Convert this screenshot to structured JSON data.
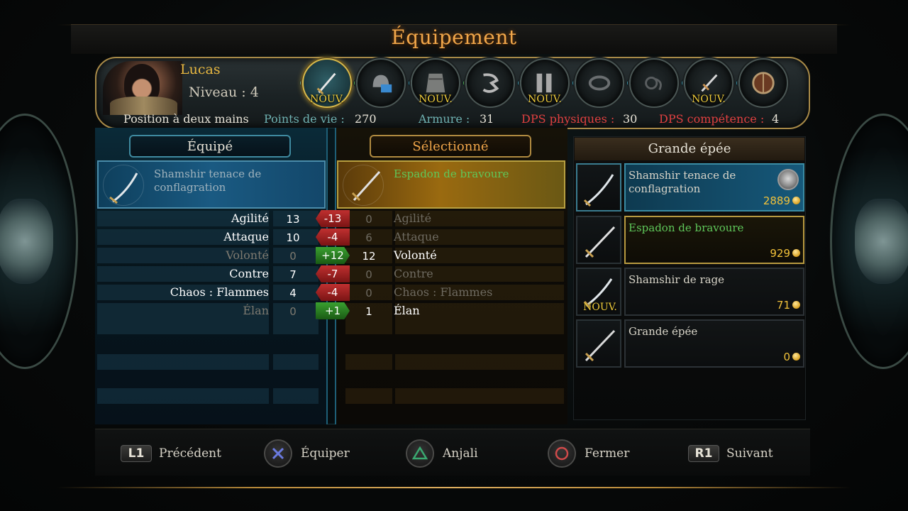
{
  "screen": {
    "title": "Équipement"
  },
  "character": {
    "name": "Lucas",
    "level_label": "Niveau :",
    "level": "4"
  },
  "slots": [
    {
      "icon": "sword-icon",
      "new": "NOUV.",
      "active": true
    },
    {
      "icon": "helmet-icon",
      "new": ""
    },
    {
      "icon": "chest-armor-icon",
      "new": "NOUV."
    },
    {
      "icon": "gloves-icon",
      "new": ""
    },
    {
      "icon": "boots-icon",
      "new": "NOUV."
    },
    {
      "icon": "ring-icon",
      "new": ""
    },
    {
      "icon": "amulet-icon",
      "new": ""
    },
    {
      "icon": "dagger-icon",
      "new": "NOUV."
    },
    {
      "icon": "shield-icon",
      "new": ""
    }
  ],
  "stats": {
    "stance": "Position à deux mains",
    "hp_label": "Points de vie :",
    "hp": "270",
    "armor_label": "Armure :",
    "armor": "31",
    "dps_phys_label": "DPS physiques :",
    "dps_phys": "30",
    "dps_skill_label": "DPS compétence :",
    "dps_skill": "4"
  },
  "compare": {
    "equipped_tab": "Équipé",
    "selected_tab": "Sélectionné",
    "equipped_item": "Shamshir tenace de conflagration",
    "selected_item": "Espadon de bravoure",
    "rows": [
      {
        "label": "Agilité",
        "eq": "13",
        "diff": "-13",
        "sel": "0",
        "sign": "neg"
      },
      {
        "label": "Attaque",
        "eq": "10",
        "diff": "-4",
        "sel": "6",
        "sign": "neg"
      },
      {
        "label": "Volonté",
        "eq": "0",
        "diff": "+12",
        "sel": "12",
        "sign": "pos"
      },
      {
        "label": "Contre",
        "eq": "7",
        "diff": "-7",
        "sel": "0",
        "sign": "neg"
      },
      {
        "label": "Chaos : Flammes",
        "eq": "4",
        "diff": "-4",
        "sel": "0",
        "sign": "neg"
      },
      {
        "label": "Élan",
        "eq": "0",
        "diff": "+1",
        "sel": "1",
        "sign": "pos"
      }
    ]
  },
  "inventory": {
    "category": "Grande épée",
    "items": [
      {
        "name": "Shamshir tenace de conflagration",
        "price": "2889",
        "state": "cur",
        "new": ""
      },
      {
        "name": "Espadon de bravoure",
        "price": "929",
        "state": "sel",
        "new": ""
      },
      {
        "name": "Shamshir de rage",
        "price": "71",
        "state": "",
        "new": "NOUV."
      },
      {
        "name": "Grande épée",
        "price": "0",
        "state": "",
        "new": ""
      }
    ]
  },
  "footer": {
    "prev_key": "L1",
    "prev": "Précédent",
    "equip": "Équiper",
    "anjali": "Anjali",
    "close": "Fermer",
    "next_key": "R1",
    "next": "Suivant"
  }
}
